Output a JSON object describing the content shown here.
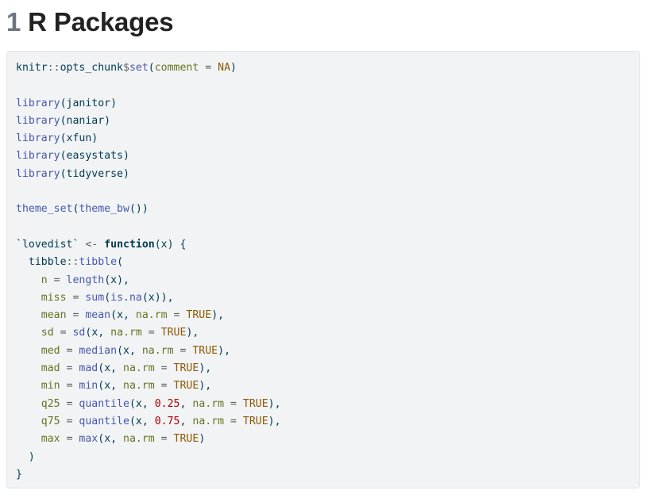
{
  "heading": {
    "number": "1",
    "title": "R Packages"
  },
  "code": {
    "language": "r",
    "lines": [
      [
        {
          "t": "txt",
          "v": "knitr"
        },
        {
          "t": "op",
          "v": "::"
        },
        {
          "t": "txt",
          "v": "opts_chunk"
        },
        {
          "t": "op",
          "v": "$"
        },
        {
          "t": "fn",
          "v": "set"
        },
        {
          "t": "txt",
          "v": "("
        },
        {
          "t": "arg",
          "v": "comment"
        },
        {
          "t": "op",
          "v": " = "
        },
        {
          "t": "cst",
          "v": "NA"
        },
        {
          "t": "txt",
          "v": ")"
        }
      ],
      [],
      [
        {
          "t": "fn",
          "v": "library"
        },
        {
          "t": "txt",
          "v": "(janitor)"
        }
      ],
      [
        {
          "t": "fn",
          "v": "library"
        },
        {
          "t": "txt",
          "v": "(naniar)"
        }
      ],
      [
        {
          "t": "fn",
          "v": "library"
        },
        {
          "t": "txt",
          "v": "(xfun)"
        }
      ],
      [
        {
          "t": "fn",
          "v": "library"
        },
        {
          "t": "txt",
          "v": "(easystats)"
        }
      ],
      [
        {
          "t": "fn",
          "v": "library"
        },
        {
          "t": "txt",
          "v": "(tidyverse)"
        }
      ],
      [],
      [
        {
          "t": "fn",
          "v": "theme_set"
        },
        {
          "t": "txt",
          "v": "("
        },
        {
          "t": "fn",
          "v": "theme_bw"
        },
        {
          "t": "txt",
          "v": "())"
        }
      ],
      [],
      [
        {
          "t": "txt",
          "v": "`lovedist` "
        },
        {
          "t": "op",
          "v": "<-"
        },
        {
          "t": "txt",
          "v": " "
        },
        {
          "t": "kw",
          "v": "function"
        },
        {
          "t": "txt",
          "v": "(x) {"
        }
      ],
      [
        {
          "t": "txt",
          "v": "  tibble"
        },
        {
          "t": "op",
          "v": "::"
        },
        {
          "t": "fn",
          "v": "tibble"
        },
        {
          "t": "txt",
          "v": "("
        }
      ],
      [
        {
          "t": "txt",
          "v": "    "
        },
        {
          "t": "arg",
          "v": "n"
        },
        {
          "t": "op",
          "v": " = "
        },
        {
          "t": "fn",
          "v": "length"
        },
        {
          "t": "txt",
          "v": "(x),"
        }
      ],
      [
        {
          "t": "txt",
          "v": "    "
        },
        {
          "t": "arg",
          "v": "miss"
        },
        {
          "t": "op",
          "v": " = "
        },
        {
          "t": "fn",
          "v": "sum"
        },
        {
          "t": "txt",
          "v": "("
        },
        {
          "t": "fn",
          "v": "is.na"
        },
        {
          "t": "txt",
          "v": "(x)),"
        }
      ],
      [
        {
          "t": "txt",
          "v": "    "
        },
        {
          "t": "arg",
          "v": "mean"
        },
        {
          "t": "op",
          "v": " = "
        },
        {
          "t": "fn",
          "v": "mean"
        },
        {
          "t": "txt",
          "v": "(x, "
        },
        {
          "t": "arg",
          "v": "na.rm"
        },
        {
          "t": "op",
          "v": " = "
        },
        {
          "t": "cst",
          "v": "TRUE"
        },
        {
          "t": "txt",
          "v": "),"
        }
      ],
      [
        {
          "t": "txt",
          "v": "    "
        },
        {
          "t": "arg",
          "v": "sd"
        },
        {
          "t": "op",
          "v": " = "
        },
        {
          "t": "fn",
          "v": "sd"
        },
        {
          "t": "txt",
          "v": "(x, "
        },
        {
          "t": "arg",
          "v": "na.rm"
        },
        {
          "t": "op",
          "v": " = "
        },
        {
          "t": "cst",
          "v": "TRUE"
        },
        {
          "t": "txt",
          "v": "),"
        }
      ],
      [
        {
          "t": "txt",
          "v": "    "
        },
        {
          "t": "arg",
          "v": "med"
        },
        {
          "t": "op",
          "v": " = "
        },
        {
          "t": "fn",
          "v": "median"
        },
        {
          "t": "txt",
          "v": "(x, "
        },
        {
          "t": "arg",
          "v": "na.rm"
        },
        {
          "t": "op",
          "v": " = "
        },
        {
          "t": "cst",
          "v": "TRUE"
        },
        {
          "t": "txt",
          "v": "),"
        }
      ],
      [
        {
          "t": "txt",
          "v": "    "
        },
        {
          "t": "arg",
          "v": "mad"
        },
        {
          "t": "op",
          "v": " = "
        },
        {
          "t": "fn",
          "v": "mad"
        },
        {
          "t": "txt",
          "v": "(x, "
        },
        {
          "t": "arg",
          "v": "na.rm"
        },
        {
          "t": "op",
          "v": " = "
        },
        {
          "t": "cst",
          "v": "TRUE"
        },
        {
          "t": "txt",
          "v": "),"
        }
      ],
      [
        {
          "t": "txt",
          "v": "    "
        },
        {
          "t": "arg",
          "v": "min"
        },
        {
          "t": "op",
          "v": " = "
        },
        {
          "t": "fn",
          "v": "min"
        },
        {
          "t": "txt",
          "v": "(x, "
        },
        {
          "t": "arg",
          "v": "na.rm"
        },
        {
          "t": "op",
          "v": " = "
        },
        {
          "t": "cst",
          "v": "TRUE"
        },
        {
          "t": "txt",
          "v": "),"
        }
      ],
      [
        {
          "t": "txt",
          "v": "    "
        },
        {
          "t": "arg",
          "v": "q25"
        },
        {
          "t": "op",
          "v": " = "
        },
        {
          "t": "fn",
          "v": "quantile"
        },
        {
          "t": "txt",
          "v": "(x, "
        },
        {
          "t": "num-lit",
          "v": "0.25"
        },
        {
          "t": "txt",
          "v": ", "
        },
        {
          "t": "arg",
          "v": "na.rm"
        },
        {
          "t": "op",
          "v": " = "
        },
        {
          "t": "cst",
          "v": "TRUE"
        },
        {
          "t": "txt",
          "v": "),"
        }
      ],
      [
        {
          "t": "txt",
          "v": "    "
        },
        {
          "t": "arg",
          "v": "q75"
        },
        {
          "t": "op",
          "v": " = "
        },
        {
          "t": "fn",
          "v": "quantile"
        },
        {
          "t": "txt",
          "v": "(x, "
        },
        {
          "t": "num-lit",
          "v": "0.75"
        },
        {
          "t": "txt",
          "v": ", "
        },
        {
          "t": "arg",
          "v": "na.rm"
        },
        {
          "t": "op",
          "v": " = "
        },
        {
          "t": "cst",
          "v": "TRUE"
        },
        {
          "t": "txt",
          "v": "),"
        }
      ],
      [
        {
          "t": "txt",
          "v": "    "
        },
        {
          "t": "arg",
          "v": "max"
        },
        {
          "t": "op",
          "v": " = "
        },
        {
          "t": "fn",
          "v": "max"
        },
        {
          "t": "txt",
          "v": "(x, "
        },
        {
          "t": "arg",
          "v": "na.rm"
        },
        {
          "t": "op",
          "v": " = "
        },
        {
          "t": "cst",
          "v": "TRUE"
        },
        {
          "t": "txt",
          "v": ")"
        }
      ],
      [
        {
          "t": "txt",
          "v": "  )"
        }
      ],
      [
        {
          "t": "txt",
          "v": "}"
        }
      ]
    ]
  },
  "colors": {
    "code_background": "#f1f3f5",
    "function": "#4758ab",
    "argument": "#657422",
    "constant": "#8f5902",
    "number": "#ad0000",
    "default_text": "#003b4f",
    "heading_number": "#6c757d",
    "heading_text": "#222222"
  }
}
